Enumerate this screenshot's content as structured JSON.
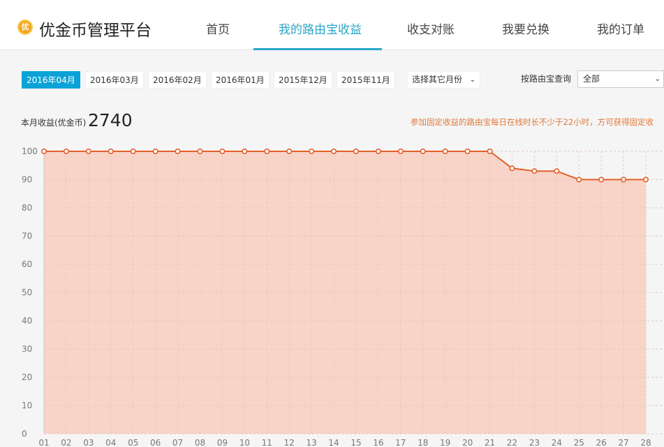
{
  "header": {
    "logo_glyph": "优",
    "title": "优金币管理平台",
    "nav": [
      {
        "label": "首页",
        "active": false
      },
      {
        "label": "我的路由宝收益",
        "active": true
      },
      {
        "label": "收支对账",
        "active": false
      },
      {
        "label": "我要兑换",
        "active": false
      },
      {
        "label": "我的订单",
        "active": false
      }
    ]
  },
  "filters": {
    "months": [
      {
        "label": "2016年04月",
        "active": true
      },
      {
        "label": "2016年03月",
        "active": false
      },
      {
        "label": "2016年02月",
        "active": false
      },
      {
        "label": "2016年01月",
        "active": false
      },
      {
        "label": "2015年12月",
        "active": false
      },
      {
        "label": "2015年11月",
        "active": false
      }
    ],
    "other_month": "选择其它月份",
    "router_label": "按路由宝查询",
    "router_value": "全部"
  },
  "summary": {
    "label": "本月收益(优金币)",
    "value": "2740",
    "notice": "参加固定收益的路由宝每日在线时长不少于22小时，方可获得固定收"
  },
  "colors": {
    "accent": "#2aa6c9",
    "active_month": "#0ba3d7",
    "line": "#e35f2a",
    "area": "#f8d3c7",
    "notice": "#e07a3a"
  },
  "chart_data": {
    "type": "area",
    "x": [
      "01",
      "02",
      "03",
      "04",
      "05",
      "06",
      "07",
      "08",
      "09",
      "10",
      "11",
      "12",
      "13",
      "14",
      "15",
      "16",
      "17",
      "18",
      "19",
      "20",
      "21",
      "22",
      "23",
      "24",
      "25",
      "26",
      "27",
      "28"
    ],
    "series": [
      {
        "values": [
          100,
          100,
          100,
          100,
          100,
          100,
          100,
          100,
          100,
          100,
          100,
          100,
          100,
          100,
          100,
          100,
          100,
          100,
          100,
          100,
          100,
          94,
          93,
          93,
          90,
          90,
          90,
          90
        ]
      }
    ],
    "yticks": [
      0,
      10,
      20,
      30,
      40,
      50,
      60,
      70,
      80,
      90,
      100
    ],
    "ylim": [
      0,
      100
    ],
    "grid": true
  }
}
